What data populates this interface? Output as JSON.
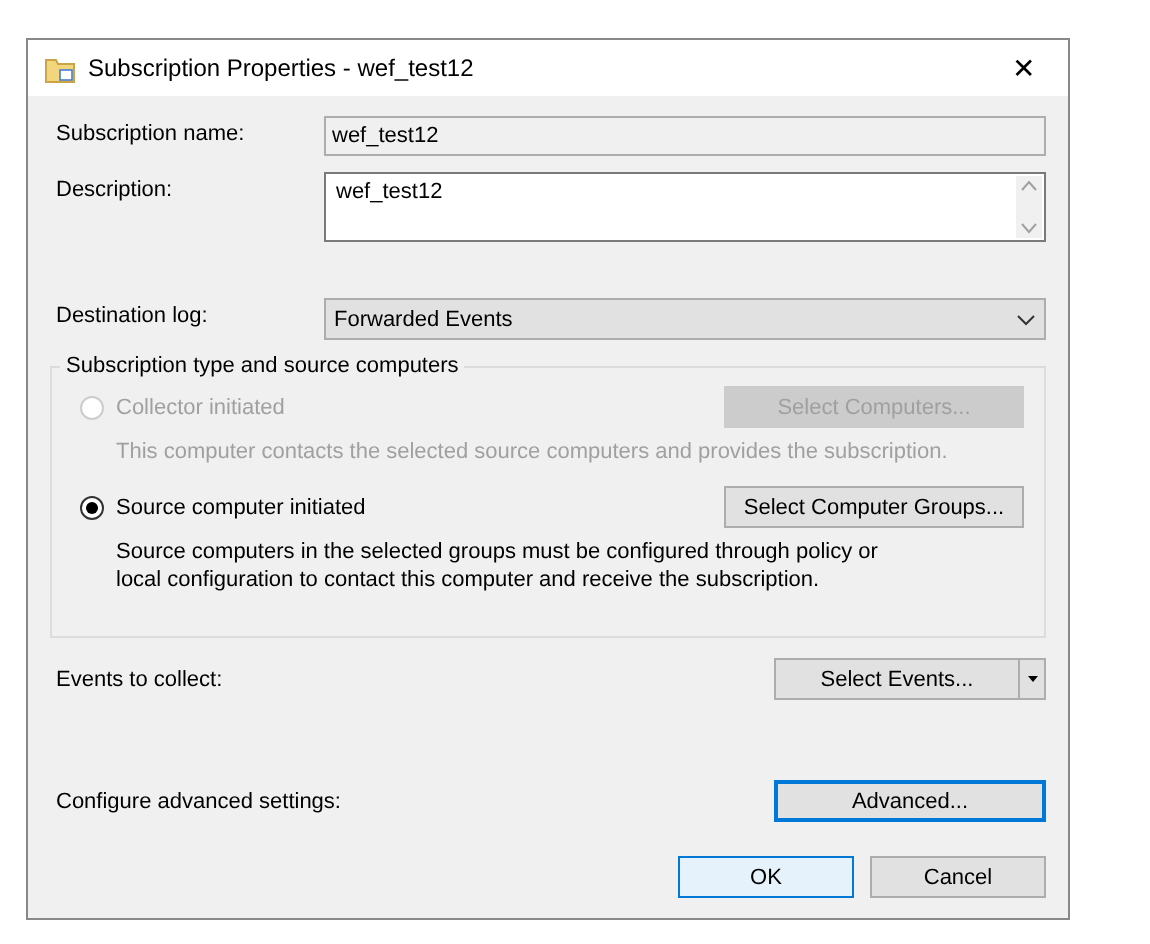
{
  "window": {
    "title": "Subscription Properties - wef_test12",
    "close": "✕"
  },
  "fields": [
    {
      "kind": "readonly",
      "label": "Subscription name:",
      "value": "wef_test12"
    },
    {
      "kind": "textarea",
      "label": "Description:",
      "value": "wef_test12"
    },
    {
      "kind": "dropdown",
      "label": "Destination log:",
      "value": "Forwarded Events"
    }
  ],
  "group": {
    "title": "Subscription type and source computers",
    "options": [
      {
        "label": "Collector initiated",
        "selected": false,
        "disabled": true,
        "button": "Select Computers...",
        "note": [
          "This computer contacts the selected source computers and provides the subscription."
        ]
      },
      {
        "label": "Source computer initiated",
        "selected": true,
        "disabled": false,
        "button": "Select Computer Groups...",
        "note": [
          "Source computers in the selected groups must be configured through policy or",
          "local configuration to contact this computer and receive the subscription."
        ]
      }
    ]
  },
  "actions": [
    {
      "kind": "split",
      "label": "Events to collect:",
      "button": "Select Events...",
      "focused": false
    },
    {
      "kind": "plain",
      "label": "Configure advanced settings:",
      "button": "Advanced...",
      "focused": true
    }
  ],
  "buttons": [
    {
      "label": "OK",
      "default": true
    },
    {
      "label": "Cancel",
      "default": false
    }
  ]
}
